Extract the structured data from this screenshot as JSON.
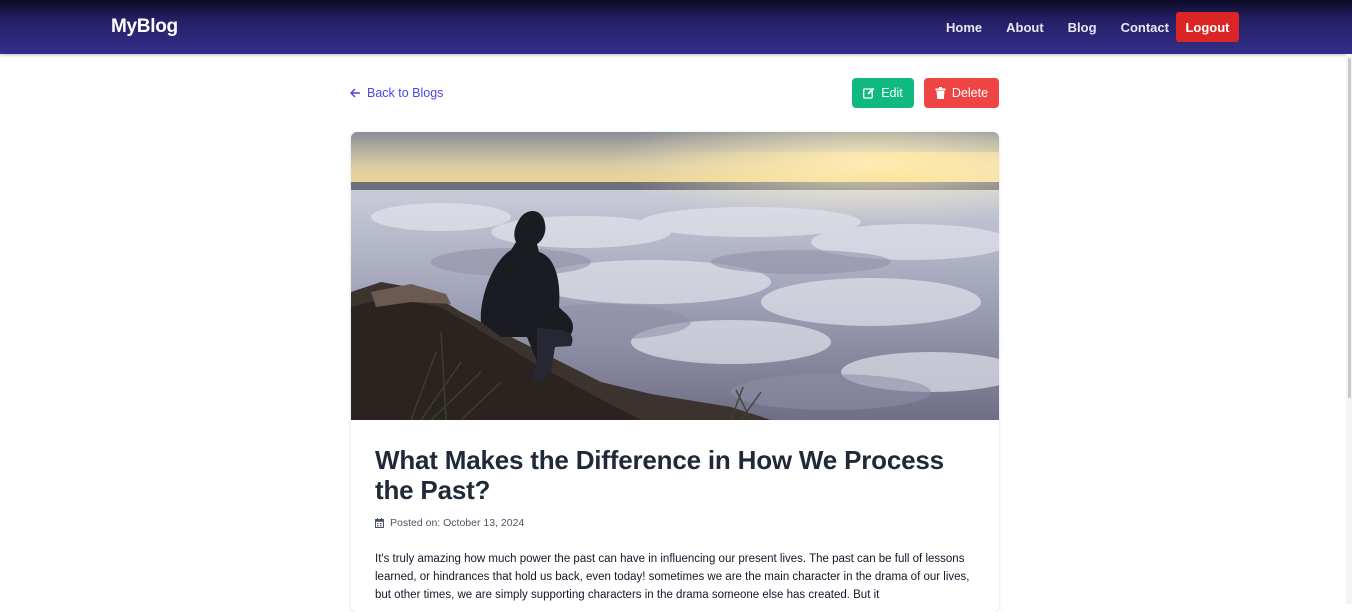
{
  "nav": {
    "brand": "MyBlog",
    "links": [
      "Home",
      "About",
      "Blog",
      "Contact"
    ],
    "logout": "Logout"
  },
  "actions": {
    "back": "Back to Blogs",
    "edit": "Edit",
    "delete": "Delete"
  },
  "post": {
    "title": "What Makes the Difference in How We Process the Past?",
    "meta": "Posted on: October 13, 2024",
    "body": "It's truly amazing how much power the past can have in influencing our present lives. The past can be full of lessons learned, or hindrances that hold us back, even today! sometimes we are the main character in the drama of our lives, but other times, we are simply supporting characters in the drama someone else has created. But it"
  },
  "colors": {
    "accent": "#4f46e5",
    "edit": "#10b981",
    "delete": "#ef4444",
    "logout": "#dc2626",
    "nav": "#342f8a"
  }
}
